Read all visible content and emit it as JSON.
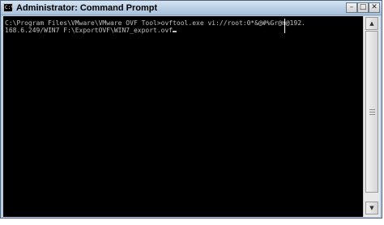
{
  "window": {
    "title": "Administrator: Command Prompt",
    "icon": "command-prompt-icon",
    "icon_glyph": "C:\\",
    "controls": {
      "minimize": "–",
      "maximize": "□",
      "close": "✕"
    }
  },
  "console": {
    "line1": "C:\\Program Files\\VMware\\VMware OVF Tool>ovftool.exe vi://root:0*&@#%Gr@m@192.",
    "line2": "168.6.249/WIN7 F:\\ExportOVF\\WIN7_export.ovf",
    "text_color": "#c0c0c0",
    "background": "#000000"
  },
  "scrollbar": {
    "up_arrow": "▲",
    "down_arrow": "▼"
  }
}
